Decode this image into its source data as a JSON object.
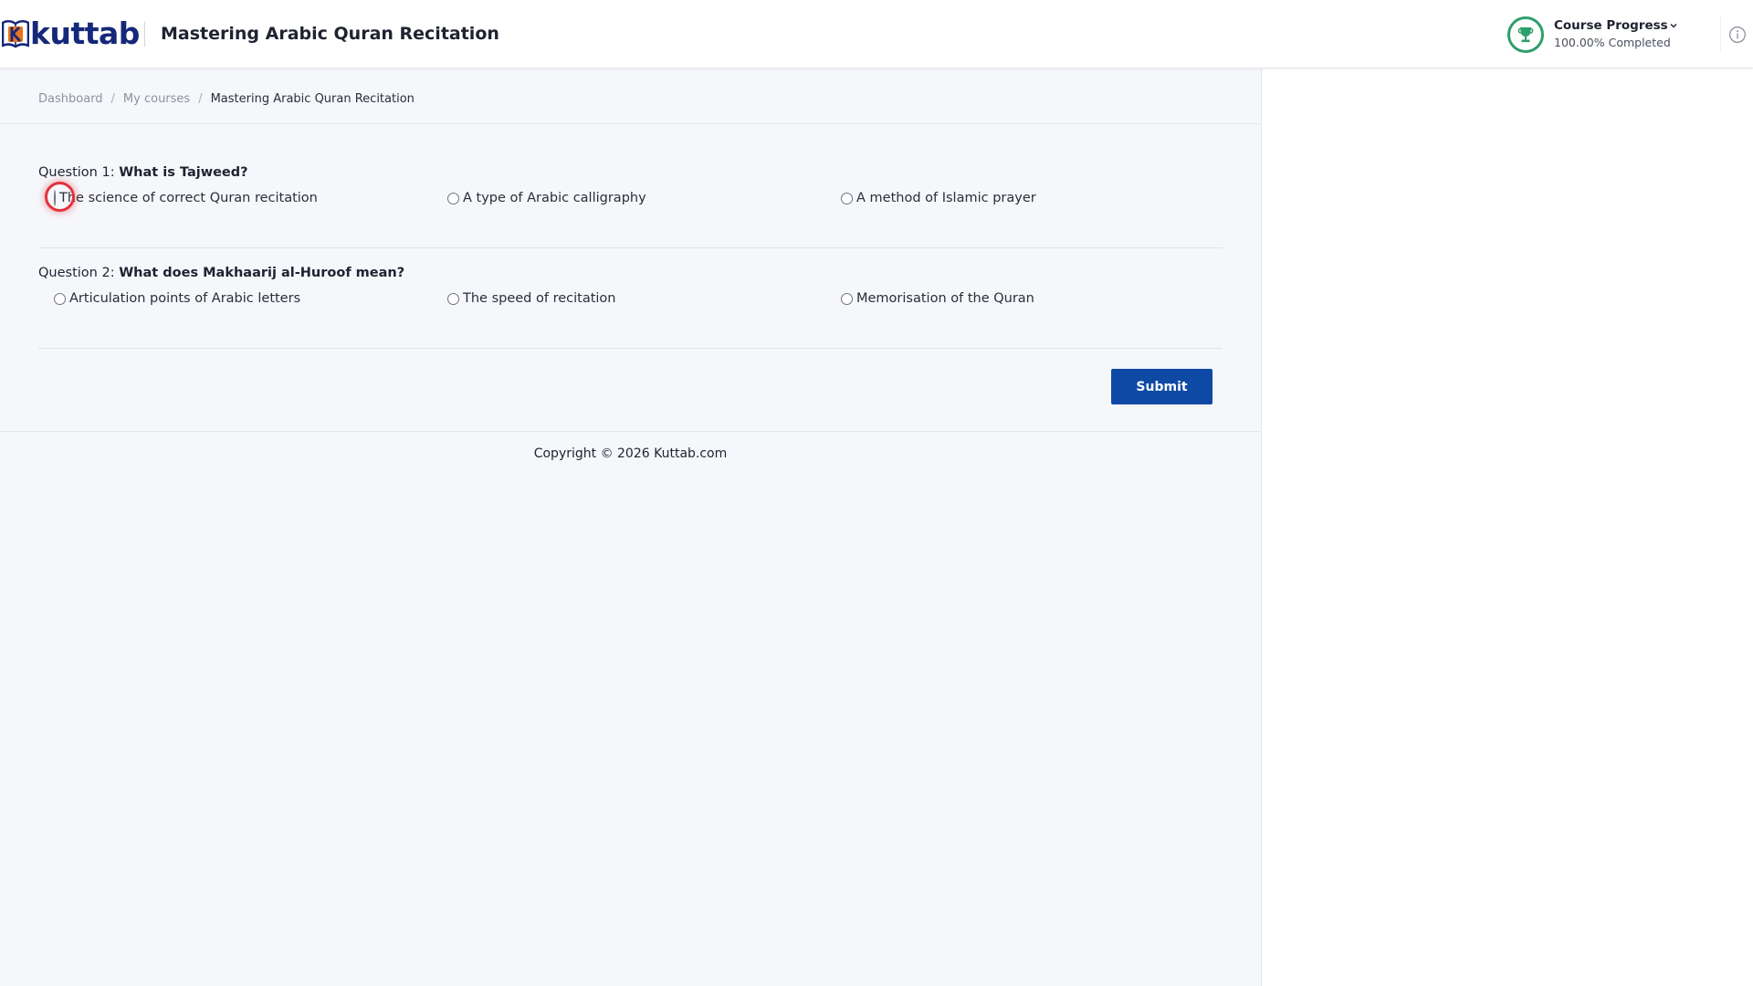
{
  "header": {
    "logo_text": "kuttab",
    "course_title": "Mastering Arabic Quran Recitation",
    "progress": {
      "title": "Course Progress",
      "completed_text": "100.00% Completed",
      "completed_fraction": 1.0
    },
    "icons": {
      "logo": "book-k-logo-icon",
      "trophy": "trophy-icon",
      "chevron": "chevron-down-icon",
      "info": "info-icon"
    }
  },
  "breadcrumb": {
    "items": [
      "Dashboard",
      "My courses"
    ],
    "separator": "/",
    "current": "Mastering Arabic Quran Recitation"
  },
  "quiz": {
    "questions": [
      {
        "prefix": "Question 1:",
        "text": "What is Tajweed?",
        "options": [
          "The science of correct Quran recitation",
          "A type of Arabic calligraphy",
          "A method of Islamic prayer"
        ],
        "focused_option": 0
      },
      {
        "prefix": "Question 2:",
        "text": "What does Makhaarij al-Huroof mean?",
        "options": [
          "Articulation points of Arabic letters",
          "The speed of recitation",
          "Memorisation of the Quran"
        ]
      }
    ],
    "submit_label": "Submit"
  },
  "footer": {
    "copyright": "Copyright © 2026 Kuttab.com"
  },
  "colors": {
    "brand_navy": "#16287a",
    "brand_orange": "#e8731c",
    "primary_button": "#0e4aa5",
    "progress_green": "#2e9e6b",
    "focus_red": "#e2333b",
    "main_background": "#f6f7fb"
  }
}
